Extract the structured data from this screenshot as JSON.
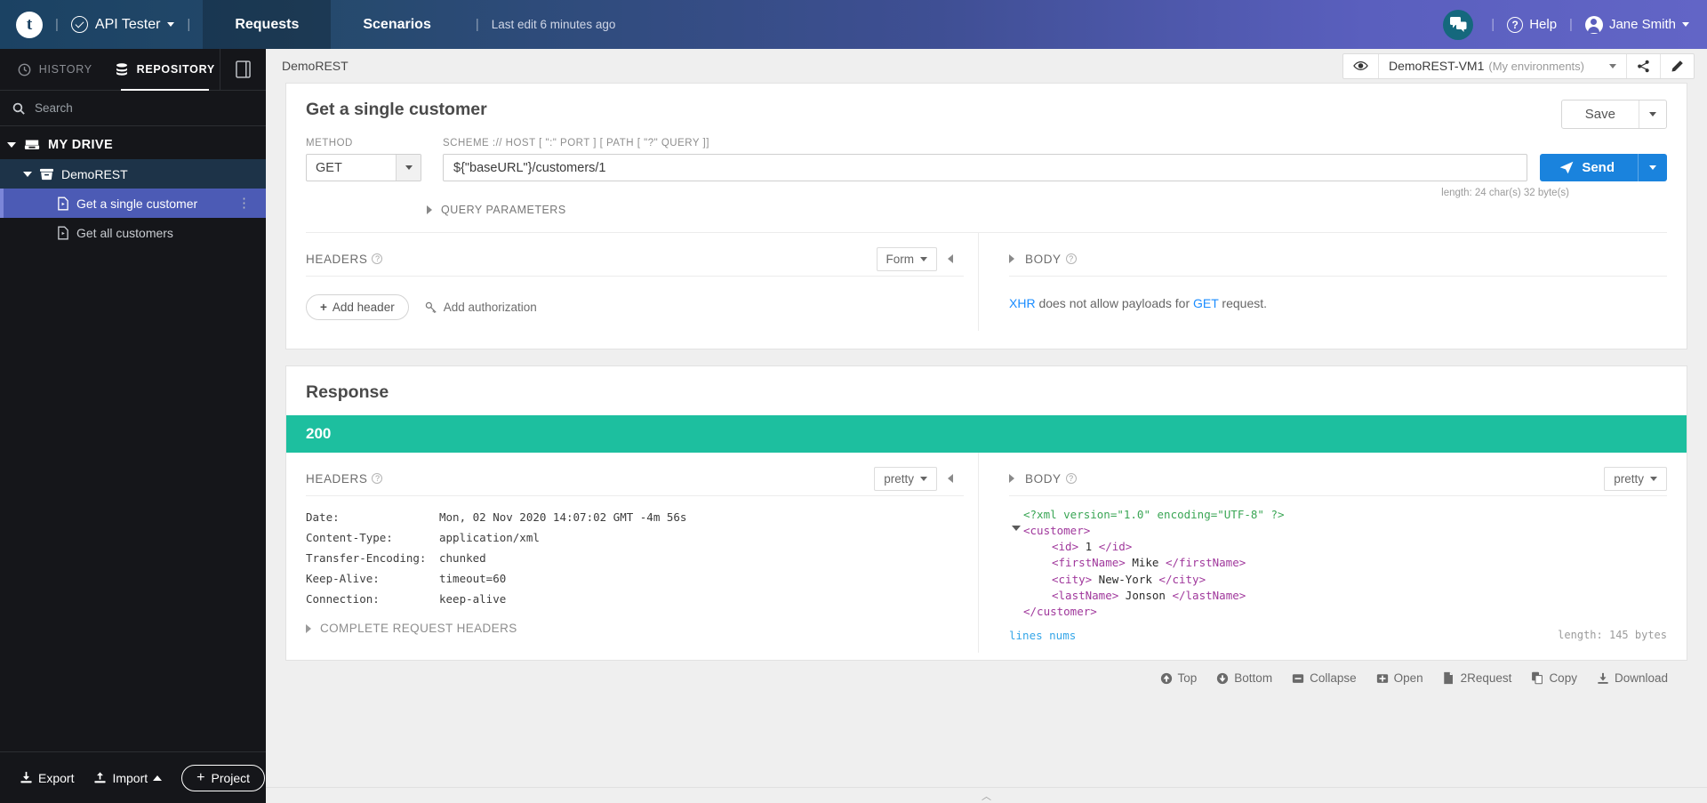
{
  "topbar": {
    "logo_letter": "t",
    "app_name": "API Tester",
    "tabs": [
      {
        "label": "Requests",
        "active": true
      },
      {
        "label": "Scenarios",
        "active": false
      }
    ],
    "last_edit": "Last edit 6 minutes ago",
    "help_label": "Help",
    "user_name": "Jane Smith",
    "chat_icon": "chat-bubbles-icon",
    "help_icon": "question-circle-icon",
    "avatar_icon": "user-avatar-icon"
  },
  "sidebar": {
    "tabs": [
      {
        "label": "HISTORY",
        "icon": "clock-icon",
        "active": false
      },
      {
        "label": "REPOSITORY",
        "icon": "database-icon",
        "active": true
      }
    ],
    "doc_icon": "document-panel-icon",
    "search": {
      "placeholder": "Search",
      "value": "",
      "icon": "search-icon"
    },
    "tree": [
      {
        "label": "MY DRIVE",
        "level": 0,
        "icon": "drive-icon",
        "expanded": true,
        "selected": false
      },
      {
        "label": "DemoREST",
        "level": 1,
        "icon": "folder-icon",
        "expanded": true,
        "selected": false,
        "folder_active": true
      },
      {
        "label": "Get a single customer",
        "level": 2,
        "icon": "request-file-icon",
        "selected": true
      },
      {
        "label": "Get all customers",
        "level": 2,
        "icon": "request-file-icon",
        "selected": false
      }
    ],
    "footer": {
      "export_label": "Export",
      "import_label": "Import",
      "project_label": "Project"
    }
  },
  "envbar": {
    "breadcrumb": "DemoREST",
    "eye_icon": "eye-icon",
    "environment": "DemoREST-VM1",
    "environment_scope": "(My environments)",
    "share_icon": "share-icon",
    "edit_icon": "pencil-icon"
  },
  "request": {
    "title": "Get a single customer",
    "save_label": "Save",
    "method_label": "METHOD",
    "method_value": "GET",
    "url_label": "SCHEME :// HOST [ \":\" PORT ] [ PATH [ \"?\" QUERY ]]",
    "url_value": "${\"baseURL\"}/customers/1",
    "send_label": "Send",
    "length_note": "length: 24 char(s) 32 byte(s)",
    "query_params_label": "QUERY PARAMETERS",
    "headers_label": "HEADERS",
    "headers_mode": "Form",
    "add_header_label": "Add header",
    "add_authorization_label": "Add authorization",
    "body_label": "BODY",
    "body_note_prefix": "XHR",
    "body_note_middle": " does not allow payloads for ",
    "body_note_method": "GET",
    "body_note_suffix": " request."
  },
  "response": {
    "title": "Response",
    "status_code": "200",
    "headers_label": "HEADERS",
    "headers_mode": "pretty",
    "body_label": "BODY",
    "body_mode": "pretty",
    "headers": [
      {
        "key": "Date:",
        "value": "Mon, 02 Nov 2020 14:07:02 GMT -4m 56s"
      },
      {
        "key": "Content-Type:",
        "value": "application/xml"
      },
      {
        "key": "Transfer-Encoding:",
        "value": "chunked"
      },
      {
        "key": "Keep-Alive:",
        "value": "timeout=60"
      },
      {
        "key": "Connection:",
        "value": "keep-alive"
      }
    ],
    "complete_headers_label": "COMPLETE REQUEST HEADERS",
    "xml": {
      "declaration": "<?xml version=\"1.0\" encoding=\"UTF-8\" ?>",
      "root_open": "<customer>",
      "root_close": "</customer>",
      "fields": [
        {
          "open": "<id>",
          "value": " 1 ",
          "close": "</id>"
        },
        {
          "open": "<firstName>",
          "value": " Mike ",
          "close": "</firstName>"
        },
        {
          "open": "<city>",
          "value": " New-York ",
          "close": "</city>"
        },
        {
          "open": "<lastName>",
          "value": " Jonson ",
          "close": "</lastName>"
        }
      ]
    },
    "lines_nums_label": "lines nums",
    "length_label": "length: 145 bytes",
    "toolbar": [
      {
        "label": "Top",
        "icon": "arrow-up-circle-icon"
      },
      {
        "label": "Bottom",
        "icon": "arrow-down-circle-icon"
      },
      {
        "label": "Collapse",
        "icon": "minus-square-icon"
      },
      {
        "label": "Open",
        "icon": "plus-square-icon"
      },
      {
        "label": "2Request",
        "icon": "file-copy-icon"
      },
      {
        "label": "Copy",
        "icon": "copy-icon"
      },
      {
        "label": "Download",
        "icon": "download-icon"
      }
    ]
  },
  "colors": {
    "accent_blue": "#1a83dd",
    "status_green": "#1dbf9f",
    "selection_purple": "#4c5bb5",
    "link_blue": "#35a6e8",
    "xml_tag": "#a0389c",
    "xml_decl": "#3aa655"
  }
}
